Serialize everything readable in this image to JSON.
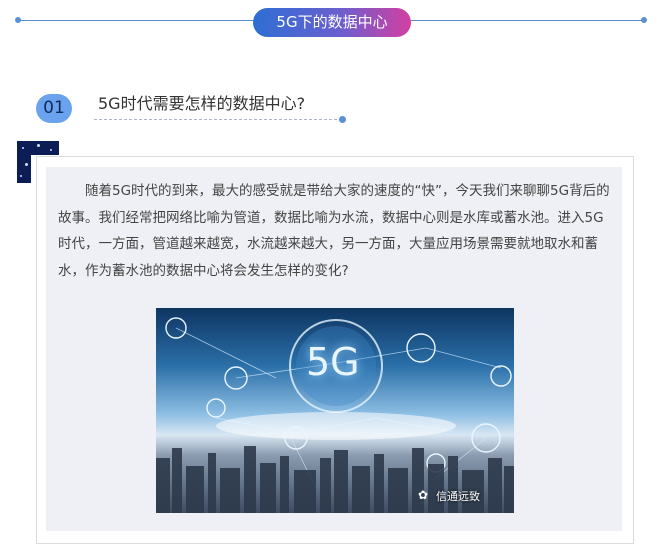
{
  "header": {
    "title": "5G下的数据中心"
  },
  "section": {
    "number": "01",
    "heading": "5G时代需要怎样的数据中心?"
  },
  "content": {
    "paragraph": "随着5G时代的到来，最大的感受就是带给大家的速度的“快”，今天我们来聊聊5G背后的故事。我们经常把网络比喻为管道，数据比喻为水流，数据中心则是水库或蓄水池。进入5G时代，一方面，管道越来越宽，水流越来越大，另一方面，大量应用场景需要就地取水和蓄水，作为蓄水池的数据中心将会发生怎样的变化?"
  },
  "image": {
    "overlay_text": "5G",
    "watermark": "信通远致"
  },
  "colors": {
    "accent": "#5b8fd6",
    "pill_start": "#2d6fd3",
    "pill_end": "#d43fa0",
    "card_bg": "#eef0f5"
  }
}
